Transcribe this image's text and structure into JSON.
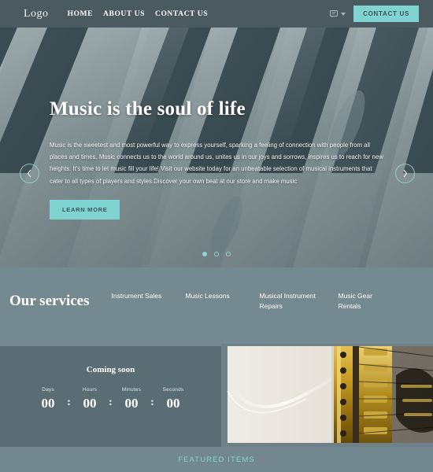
{
  "header": {
    "logo": "Logo",
    "nav": [
      {
        "label": "HOME"
      },
      {
        "label": "ABOUT US"
      },
      {
        "label": "CONTACT US"
      }
    ],
    "language_icon": "chat-bubble-icon",
    "contact_button": "CONTACT US"
  },
  "hero": {
    "title": "Music is the soul of life",
    "paragraph": "Music is the sweetest and most powerful way to express yourself, sparking a feeling of connection with people from all places and times. Music connects us to the world around us, unites us in our joys and sorrows, inspires us to reach for new heights. It's time to let music fill your life! Visit our website today for an unbeatable selection of musical instruments that cater to all types of players and styles.Discover your own beat at our store and make music",
    "cta": "LEARN MORE",
    "prev_icon": "chevron-left-icon",
    "next_icon": "chevron-right-icon",
    "slides": 3,
    "active_slide": 1,
    "background": "piano-keyboard-photo"
  },
  "services": {
    "title": "Our services",
    "items": [
      {
        "label": "Instrument Sales"
      },
      {
        "label": "Music Lessons"
      },
      {
        "label": "Musical Instrument Repairs"
      },
      {
        "label": "Music Gear Rentals"
      }
    ]
  },
  "countdown": {
    "title": "Coming soon",
    "separator": ":",
    "units": [
      {
        "label": "Days",
        "value": "00"
      },
      {
        "label": "Hours",
        "value": "00"
      },
      {
        "label": "Minutes",
        "value": "00"
      },
      {
        "label": "Seconds",
        "value": "00"
      }
    ],
    "image": "electric-guitar-photo"
  },
  "footer": {
    "featured_title": "FEATURED ITEMS"
  },
  "colors": {
    "accent": "#7fd4d2",
    "header_bg": "#4b5a61",
    "services_bg": "#758a90",
    "countdown_bg": "#5a6d75",
    "footer_bg": "#73878e"
  }
}
